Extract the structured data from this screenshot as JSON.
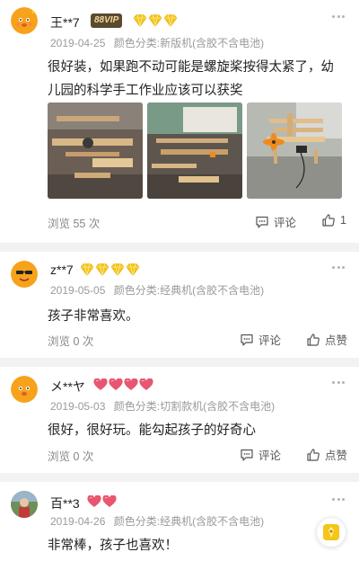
{
  "reviews": [
    {
      "user": "王**7",
      "vip_label": "88VIP",
      "badge_type": "diamond",
      "badge_count": 3,
      "date": "2019-04-25",
      "variant": "颜色分类:新版机(含胶不含电池)",
      "text": "很好装，如果跑不动可能是螺旋桨按得太紧了，幼儿园的科学手工作业应该可以获奖",
      "photos": [
        "photo-workbench",
        "photo-parts",
        "photo-finished-plane"
      ],
      "views_label": "浏览 55 次",
      "comment_label": "评论",
      "like_label": "1"
    },
    {
      "user": "z**7",
      "badge_type": "diamond",
      "badge_count": 4,
      "date": "2019-05-05",
      "variant": "颜色分类:经典机(含胶不含电池)",
      "text": "孩子非常喜欢。",
      "views_label": "浏览 0 次",
      "comment_label": "评论",
      "like_label": "点赞"
    },
    {
      "user": "メ**ヤ",
      "badge_type": "heart",
      "badge_count": 4,
      "date": "2019-05-03",
      "variant": "颜色分类:切割款机(含胶不含电池)",
      "text": "很好，很好玩。能勾起孩子的好奇心",
      "views_label": "浏览 0 次",
      "comment_label": "评论",
      "like_label": "点赞"
    },
    {
      "user": "百**3",
      "badge_type": "heart",
      "badge_count": 2,
      "date": "2019-04-26",
      "variant": "颜色分类:经典机(含胶不含电池)",
      "text": "非常棒，孩子也喜欢！"
    }
  ],
  "colors": {
    "diamond": "#f5c518",
    "heart": "#e8566f",
    "vip_bg": "#5a4a2e",
    "vip_text": "#f3d89b"
  },
  "fab_icon": "note-icon"
}
